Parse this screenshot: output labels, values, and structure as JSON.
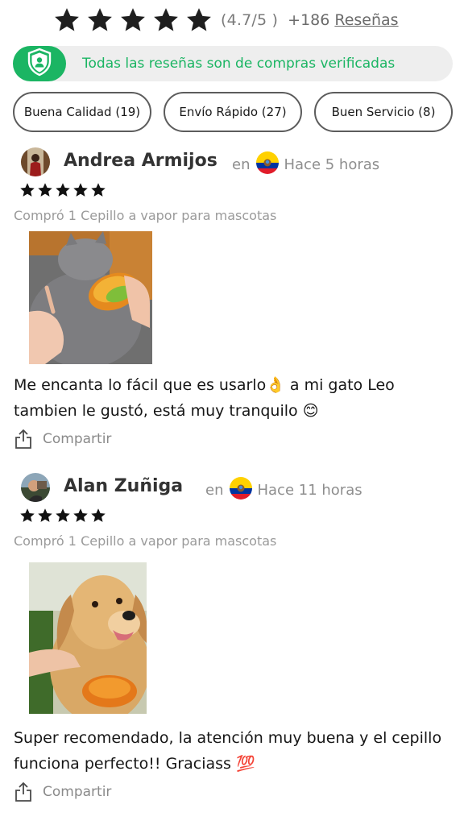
{
  "rating": {
    "stars": 5,
    "score": "(4.7/5 )",
    "count": "+186",
    "reviews_link": "Reseñas"
  },
  "verified": {
    "text": "Todas las reseñas son de compras verificadas",
    "icon": "shield-user-icon"
  },
  "filters": [
    {
      "label": "Buena Calidad (19)"
    },
    {
      "label": "Envío Rápido (27)"
    },
    {
      "label": "Buen Servicio (8)"
    }
  ],
  "reviews": [
    {
      "name": "Andrea Armijos",
      "in_label": "en",
      "flag_icon": "ecuador-flag-icon",
      "time": "Hace 5 horas",
      "stars": 5,
      "purchase": "Compró 1 Cepillo a vapor para mascotas",
      "text": "Me encanta lo fácil que es usarlo👌 a mi gato Leo tambien le gustó, está muy tranquilo 😊",
      "share_label": "Compartir"
    },
    {
      "name": "Alan Zuñiga",
      "in_label": "en",
      "flag_icon": "ecuador-flag-icon",
      "time": "Hace 11 horas",
      "stars": 5,
      "purchase": "Compró 1 Cepillo a vapor para mascotas",
      "text": "Super recomendado, la atención muy buena y el cepillo funciona perfecto!! Graciass 💯",
      "share_label": "Compartir"
    }
  ],
  "colors": {
    "accent_green": "#1bb563",
    "banner_bg": "#eeeeee",
    "star": "#1a1a1a"
  }
}
